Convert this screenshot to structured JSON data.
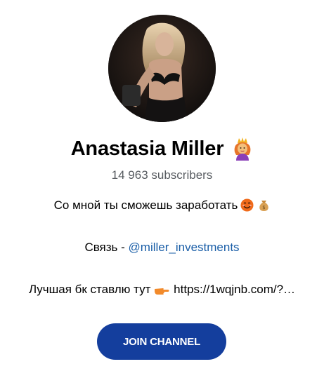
{
  "channel": {
    "name": "Anastasia Miller",
    "name_icon": "crowned-woman-emoji-icon",
    "subscribers": "14 963 subscribers"
  },
  "description": {
    "line1": "Со мной ты сможешь заработать",
    "line1_icons": [
      "smiling-face-emoji-icon",
      "money-bag-emoji-icon"
    ],
    "line2_prefix": "Связь - ",
    "line2_link": "@miller_investments",
    "line3_prefix": "Лучшая бк ставлю тут ",
    "line3_icon": "pointing-hand-emoji-icon",
    "line3_url": "https://1wqjnb.com/?…"
  },
  "actions": {
    "join_label": "JOIN CHANNEL"
  },
  "colors": {
    "join_button": "#143e9d",
    "link": "#1a5ea7",
    "muted_text": "#585c61"
  }
}
